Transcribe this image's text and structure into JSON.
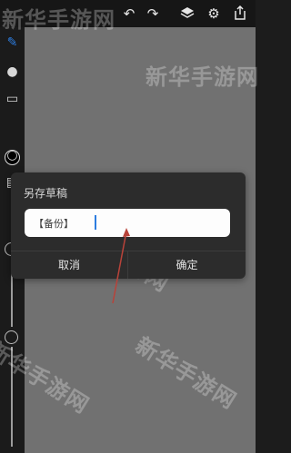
{
  "toolbar": {
    "undo_icon": "undo-icon",
    "redo_icon": "redo-icon",
    "layers_icon": "layers-icon",
    "settings_icon": "gear-icon",
    "share_icon": "share-icon"
  },
  "left_tools": {
    "brush_color": "#2d7de0",
    "active_color": "#000000"
  },
  "dialog": {
    "title": "另存草稿",
    "input_value": "【备份】",
    "cancel_label": "取消",
    "ok_label": "确定"
  },
  "watermark": {
    "text": "新华手游网"
  },
  "colors": {
    "canvas": "#717171",
    "toolbar": "#161616",
    "dialog_bg": "#2c2c2c",
    "arrow": "#b8433a",
    "caret": "#2d7de0"
  }
}
